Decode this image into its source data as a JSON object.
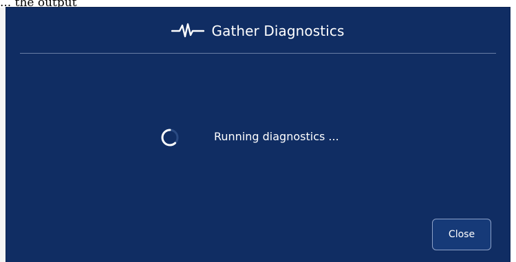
{
  "background": {
    "partial_text": "... the output"
  },
  "dialog": {
    "title": "Gather Diagnostics",
    "title_icon": "pulse-icon",
    "status_text": "Running diagnostics ...",
    "spinner_icon": "loading-spinner-icon",
    "close_label": "Close"
  },
  "colors": {
    "dialog_bg": "#102d63",
    "text": "#ffffff",
    "divider": "#6a7fa6",
    "button_border": "#8ea2c8"
  }
}
